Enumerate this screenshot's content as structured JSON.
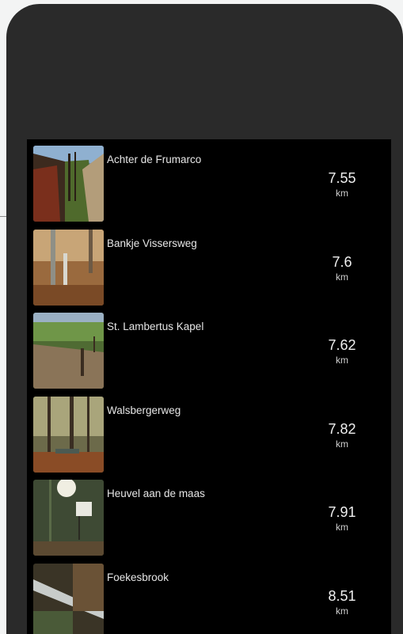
{
  "routes": [
    {
      "name": "Achter de Frumarco",
      "distance": "7.55",
      "unit": "km",
      "photo": "forest-path-photo"
    },
    {
      "name": "Bankje Vissersweg",
      "distance": "7.6",
      "unit": "km",
      "photo": "autumn-woods-photo"
    },
    {
      "name": "St. Lambertus Kapel",
      "distance": "7.62",
      "unit": "km",
      "photo": "meadow-trail-photo"
    },
    {
      "name": "Walsbergerweg",
      "distance": "7.82",
      "unit": "km",
      "photo": "bench-in-forest-photo"
    },
    {
      "name": "Heuvel aan de maas",
      "distance": "7.91",
      "unit": "km",
      "photo": "signboard-sunlight-photo"
    },
    {
      "name": "Foekesbrook",
      "distance": "8.51",
      "unit": "km",
      "photo": "stream-woods-photo"
    }
  ]
}
